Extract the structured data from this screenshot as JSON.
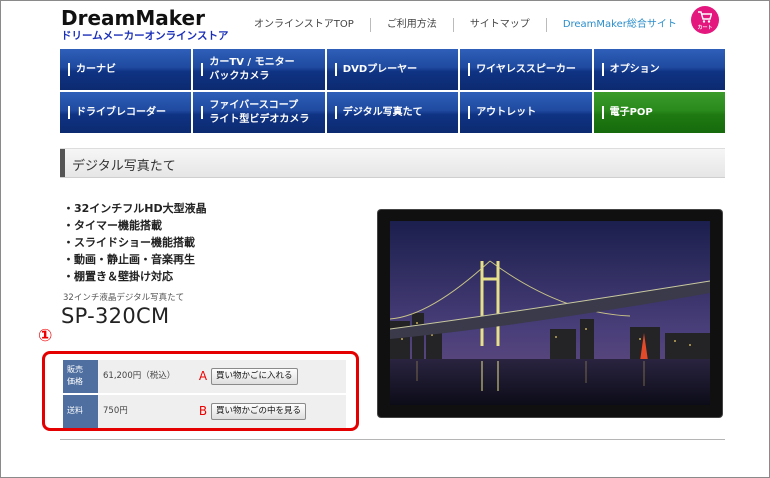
{
  "header": {
    "logo_title": "DreamMaker",
    "logo_subtitle": "ドリームメーカーオンラインストア",
    "nav": [
      {
        "label": "オンラインストアTOP"
      },
      {
        "label": "ご利用方法"
      },
      {
        "label": "サイトマップ"
      },
      {
        "label": "DreamMaker総合サイト"
      }
    ],
    "cart_label": "カート",
    "cart_color": "#e4177e"
  },
  "categories": [
    {
      "line1": "カーナビ",
      "line2": ""
    },
    {
      "line1": "カーTV / モニター",
      "line2": "バックカメラ"
    },
    {
      "line1": "DVDプレーヤー",
      "line2": ""
    },
    {
      "line1": "ワイヤレススピーカー",
      "line2": ""
    },
    {
      "line1": "オプション",
      "line2": ""
    },
    {
      "line1": "ドライブレコーダー",
      "line2": ""
    },
    {
      "line1": "ファイバースコープ",
      "line2": "ライト型ビデオカメラ"
    },
    {
      "line1": "デジタル写真たて",
      "line2": ""
    },
    {
      "line1": "アウトレット",
      "line2": ""
    },
    {
      "line1": "電子POP",
      "line2": ""
    }
  ],
  "section_title": "デジタル写真たて",
  "features": [
    "・32インチフルHD大型液晶",
    "・タイマー機能搭載",
    "・スライドショー機能搭載",
    "・動画・静止画・音楽再生",
    "・棚置き＆壁掛け対応"
  ],
  "product": {
    "subtitle": "32インチ液晶デジタル写真たて",
    "model": "SP-320CM"
  },
  "annotation_number": "①",
  "price": {
    "label_line1": "販売",
    "label_line2": "価格",
    "value": "61,200円（税込）",
    "marker": "A",
    "button": "買い物かごに入れる"
  },
  "shipping": {
    "label": "送料",
    "value": "750円",
    "marker": "B",
    "button": "買い物かごの中を見る"
  },
  "colors": {
    "nav_blue": "#1f4aa0",
    "nav_green": "#2a8a1c",
    "annotation_red": "#e40000",
    "label_blue": "#4e6fa0"
  }
}
